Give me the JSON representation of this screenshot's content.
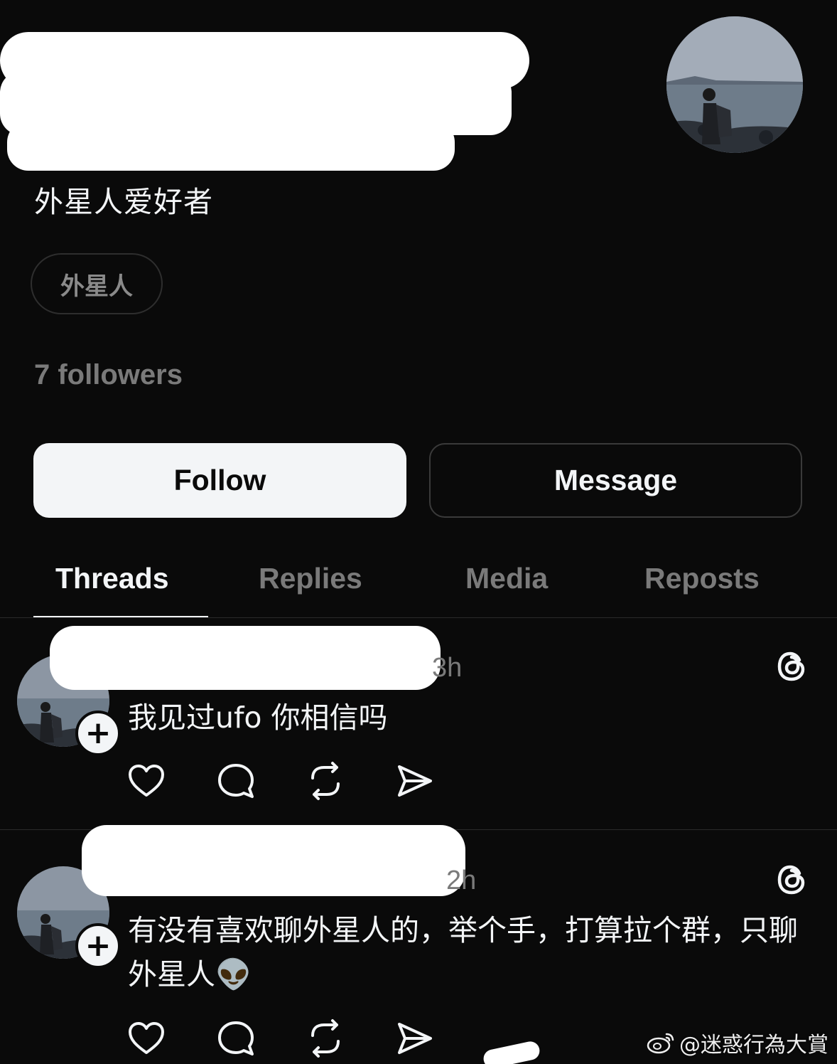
{
  "profile": {
    "bio": "外星人爱好者",
    "tag": "外星人",
    "followers": "7 followers"
  },
  "buttons": {
    "follow": "Follow",
    "message": "Message"
  },
  "tabs": {
    "threads": "Threads",
    "replies": "Replies",
    "media": "Media",
    "reposts": "Reposts"
  },
  "posts": [
    {
      "time": "3h",
      "text": "我见过ufo 你相信吗"
    },
    {
      "time": "2h",
      "text": "有没有喜欢聊外星人的，举个手，打算拉个群，只聊外星人👽"
    }
  ],
  "icons": {
    "plus": "+",
    "actions": [
      "heart-icon",
      "comment-icon",
      "repost-icon",
      "share-icon"
    ],
    "threads": "threads-logo-icon"
  },
  "watermark": "@迷惑行為大賞"
}
